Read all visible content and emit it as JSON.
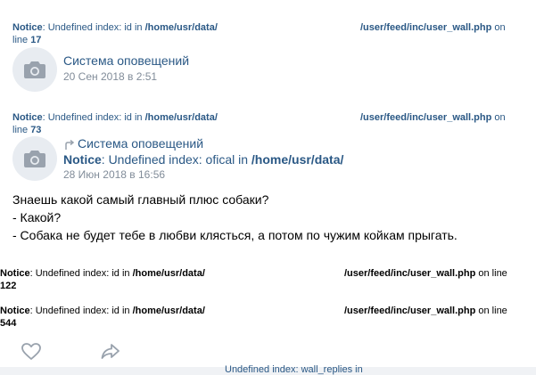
{
  "notice1": {
    "label": "Notice",
    "text": ": Undefined index: id in ",
    "path": "/home/usr/data/",
    "file": "/user/feed/inc/user_wall.php",
    "on": " on",
    "line_prefix": "line ",
    "line": "17"
  },
  "post1": {
    "author": "Система оповещений",
    "date": "20 Сен 2018 в 2:51"
  },
  "notice2": {
    "label": "Notice",
    "text": ": Undefined index: id in ",
    "path": "/home/usr/data/",
    "file": "/user/feed/inc/user_wall.php",
    "on": " on",
    "line_prefix": "line ",
    "line": "73"
  },
  "post2": {
    "repost_icon": "repost-icon",
    "author": "Система оповещений",
    "notice_label": "Notice",
    "notice_text": ": Undefined index: ofical in ",
    "notice_path": "/home/usr/data/",
    "date": "28 Июн 2018 в 16:56",
    "text_lines": [
      "Знаешь какой самый главный плюс собаки?",
      "- Какой?",
      "- Собака не будет тебе в любви клясться, а потом по чужим койкам прыгать."
    ]
  },
  "notice3": {
    "label": "Notice",
    "text": ": Undefined index: id in ",
    "path": "/home/usr/data/",
    "file": "/user/feed/inc/user_wall.php",
    "on": " on line",
    "line": "122"
  },
  "notice4": {
    "label": "Notice",
    "text": ": Undefined index: id in ",
    "path": "/home/usr/data/",
    "file": "/user/feed/inc/user_wall.php",
    "on": " on line",
    "line": "544"
  },
  "actions": {
    "like_icon": "heart-icon",
    "share_icon": "share-icon"
  },
  "bottom_notice": {
    "text": "Undefined index: wall_replies in"
  }
}
